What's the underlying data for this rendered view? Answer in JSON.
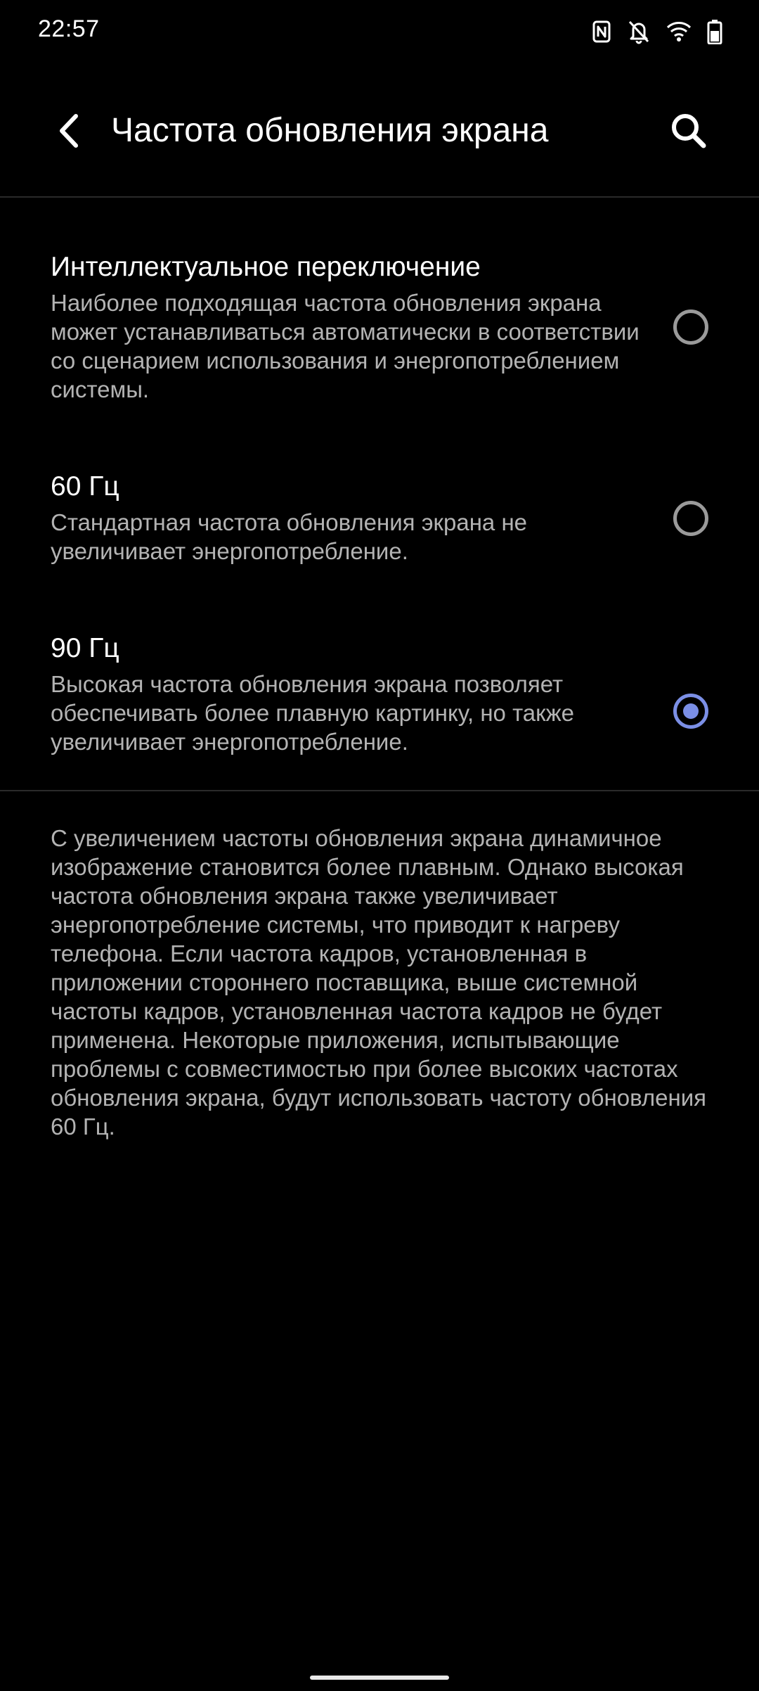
{
  "status_bar": {
    "time": "22:57",
    "icons": [
      "nfc-icon",
      "notifications-off-icon",
      "wifi-icon",
      "battery-icon"
    ]
  },
  "app_bar": {
    "title": "Частота обновления экрана",
    "back_icon": "arrow-back-icon",
    "search_icon": "search-icon"
  },
  "options": [
    {
      "title": "Интеллектуальное переключение",
      "description": "Наиболее подходящая частота обновления экрана может устанавливаться автоматически в соответствии со сценарием использования и энергопотреблением системы.",
      "selected": false
    },
    {
      "title": "60 Гц",
      "description": "Стандартная частота обновления экрана не увеличивает энергопотребление.",
      "selected": false
    },
    {
      "title": "90 Гц",
      "description": "Высокая частота обновления экрана позволяет обеспечивать более плавную картинку, но также увеличивает энергопотребление.",
      "selected": true
    }
  ],
  "footer_note": "С увеличением частоты обновления экрана динамичное изображение становится более плавным. Однако высокая частота обновления экрана также увеличивает энергопотребление системы, что приводит к нагреву телефона. Если частота кадров, установленная в приложении стороннего поставщика, выше системной частоты кадров, установленная частота кадров не будет применена. Некоторые приложения, испытывающие проблемы с совместимостью при более высоких частотах обновления экрана, будут использовать частоту обновления 60 Гц.",
  "colors": {
    "background": "#000000",
    "accent": "#7b8fe6",
    "secondary_text": "#b3b3b3",
    "radio_unchecked": "#9a9a9a"
  }
}
